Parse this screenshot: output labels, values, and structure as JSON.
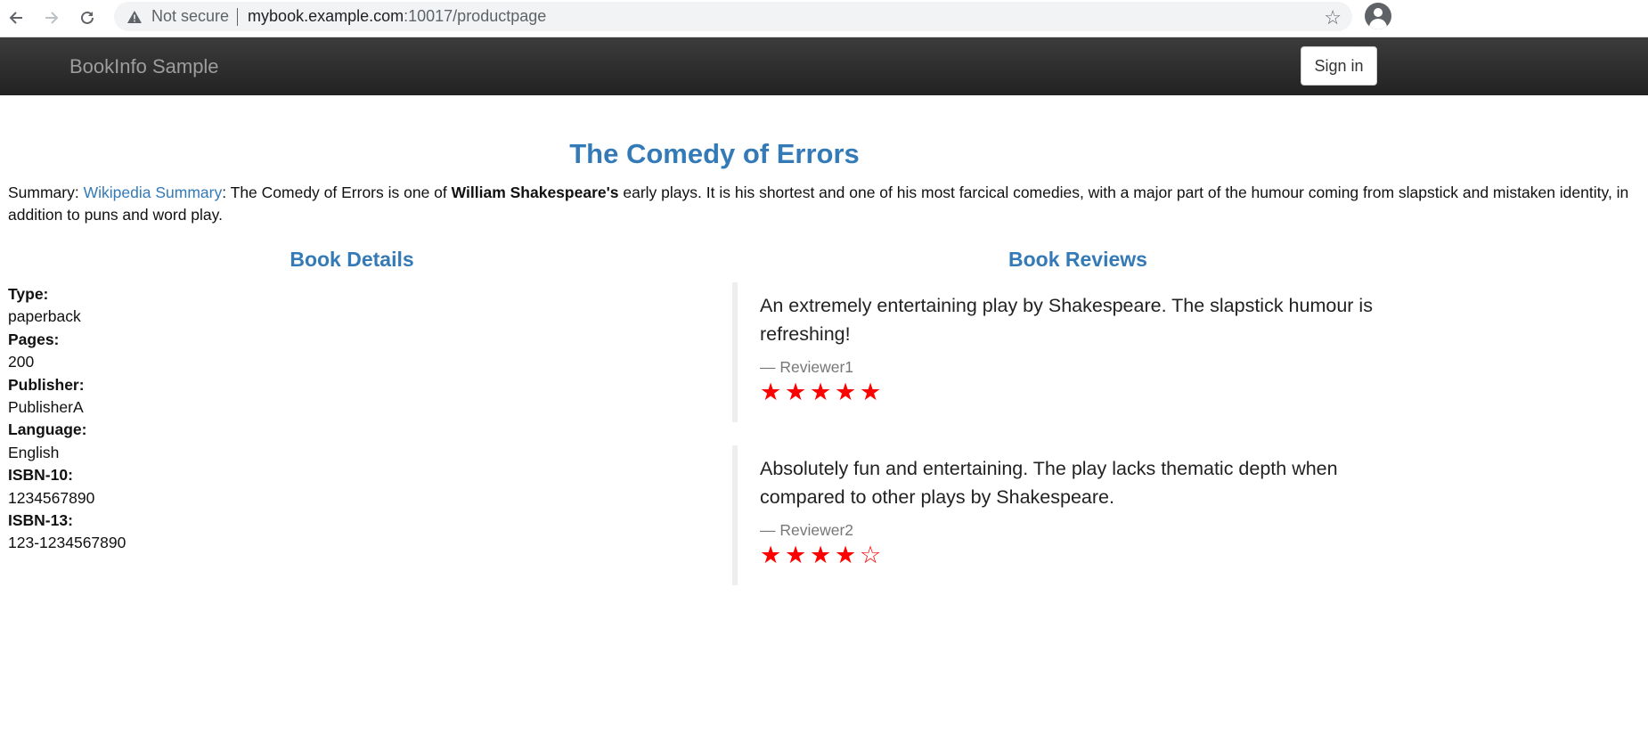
{
  "browser": {
    "url_host": "mybook.example.com",
    "url_path": ":10017/productpage",
    "security_label": "Not secure",
    "icons": [
      "back-icon",
      "forward-icon",
      "reload-icon",
      "warning-icon",
      "star-icon",
      "profile-icon"
    ]
  },
  "header": {
    "brand": "BookInfo Sample",
    "signin_label": "Sign in"
  },
  "book": {
    "title": "The Comedy of Errors",
    "summary_prefix": "Summary: ",
    "summary_link": "Wikipedia Summary",
    "summary_text_1": ": The Comedy of Errors is one of ",
    "summary_bold": "William Shakespeare's",
    "summary_text_2": " early plays. It is his shortest and one of his most farcical comedies, with a major part of the humour coming from slapstick and mistaken identity, in addition to puns and word play."
  },
  "details": {
    "heading": "Book Details",
    "fields": [
      {
        "label": "Type:",
        "value": "paperback"
      },
      {
        "label": "Pages:",
        "value": "200"
      },
      {
        "label": "Publisher:",
        "value": "PublisherA"
      },
      {
        "label": "Language:",
        "value": "English"
      },
      {
        "label": "ISBN-10:",
        "value": "1234567890"
      },
      {
        "label": "ISBN-13:",
        "value": "123-1234567890"
      }
    ]
  },
  "reviews": {
    "heading": "Book Reviews",
    "star_color": "#ff0000",
    "items": [
      {
        "text": "An extremely entertaining play by Shakespeare. The slapstick humour is refreshing!",
        "reviewer": "— Reviewer1",
        "rating": 5,
        "max": 5
      },
      {
        "text": "Absolutely fun and entertaining. The play lacks thematic depth when compared to other plays by Shakespeare.",
        "reviewer": "— Reviewer2",
        "rating": 4,
        "max": 5
      }
    ]
  },
  "colors": {
    "accent": "#337ab7",
    "header_bg": "#222222",
    "brand_text": "#9d9d9d"
  }
}
